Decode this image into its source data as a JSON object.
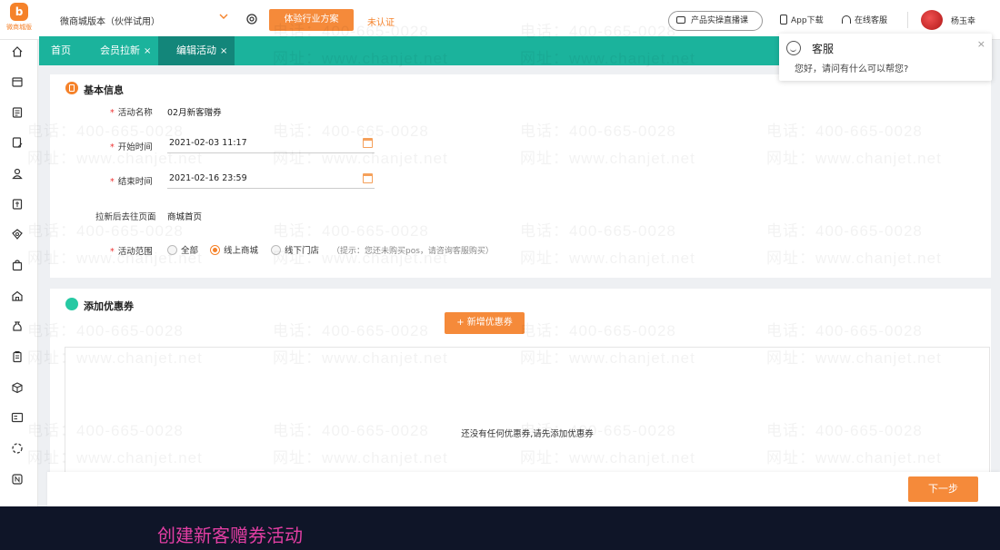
{
  "header": {
    "logo_text": "微商城版",
    "logo_mark": "b",
    "version": "微商城版本（伙伴试用）",
    "trial_button": "体验行业方案",
    "verify_status": "未认证",
    "live_button": "产品实操直播课",
    "app_download": "App下载",
    "online_service": "在线客服",
    "username": "杨玉幸"
  },
  "tabs": [
    {
      "label": "首页",
      "closable": false
    },
    {
      "label": "会员拉新",
      "closable": true
    },
    {
      "label": "编辑活动",
      "closable": true
    }
  ],
  "tab_close_glyph": "×",
  "service_popup": {
    "title": "客服",
    "message": "您好，请问有什么可以帮您?",
    "close": "×"
  },
  "basic_info": {
    "title": "基本信息",
    "required_mark": "*",
    "activity_name_label": "活动名称",
    "activity_name": "02月新客赠券",
    "start_time_label": "开始时间",
    "start_time": "2021-02-03 11:17",
    "end_time_label": "结束时间",
    "end_time": "2021-02-16 23:59",
    "redirect_label": "拉新后去往页面",
    "redirect_page": "商城首页",
    "scope_label": "活动范围",
    "scope_options": [
      "全部",
      "线上商城",
      "线下门店"
    ],
    "scope_selected": "线上商城",
    "scope_hint": "（提示：您还未购买pos，请咨询客服购买）"
  },
  "coupons": {
    "title": "添加优惠券",
    "add_button": "+ 新增优惠券",
    "empty_message": "还没有任何优惠券,请先添加优惠券"
  },
  "footer": {
    "next_button": "下一步"
  },
  "watermark": {
    "phone": "电话：400-665-0028",
    "site": "网址：www.chanjet.net"
  },
  "caption": "创建新客赠券活动",
  "colors": {
    "accent_orange": "#f58a3a",
    "tab_teal": "#1bb39c",
    "tab_active": "#13867a",
    "caption_pink": "#e23ea3"
  }
}
